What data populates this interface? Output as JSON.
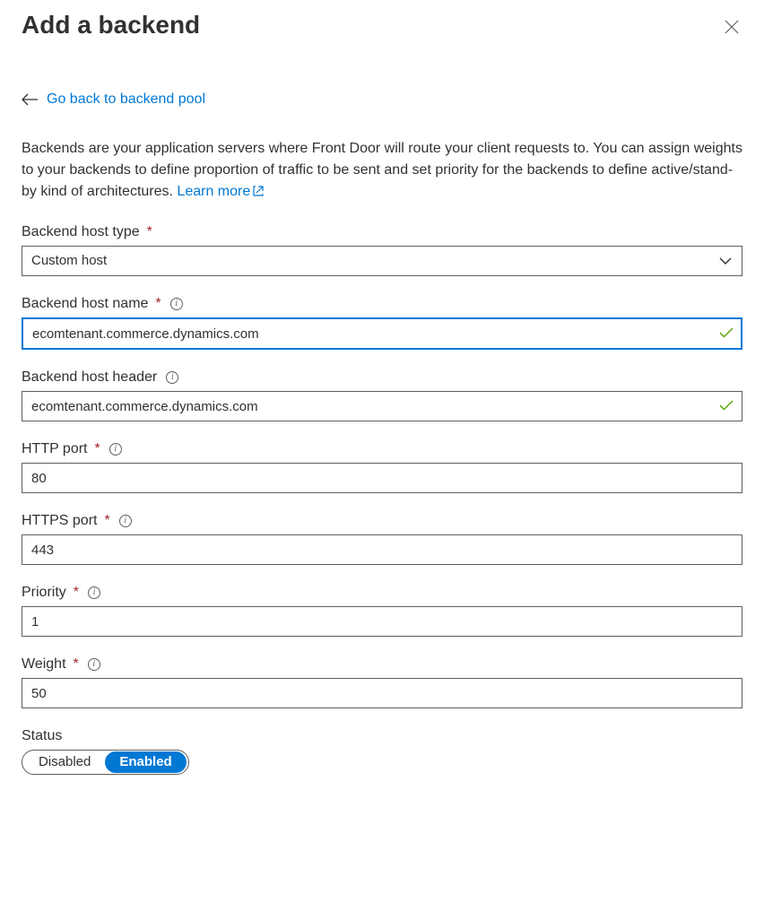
{
  "header": {
    "title": "Add a backend"
  },
  "nav": {
    "back_label": "Go back to backend pool"
  },
  "description": {
    "text": "Backends are your application servers where Front Door will route your client requests to. You can assign weights to your backends to define proportion of traffic to be sent and set priority for the backends to define active/stand-by kind of architectures. ",
    "learn_more": "Learn more"
  },
  "fields": {
    "host_type": {
      "label": "Backend host type",
      "value": "Custom host",
      "required": true
    },
    "host_name": {
      "label": "Backend host name",
      "value": "ecomtenant.commerce.dynamics.com",
      "required": true,
      "info": true
    },
    "host_header": {
      "label": "Backend host header",
      "value": "ecomtenant.commerce.dynamics.com",
      "info": true
    },
    "http_port": {
      "label": "HTTP port",
      "value": "80",
      "required": true,
      "info": true
    },
    "https_port": {
      "label": "HTTPS port",
      "value": "443",
      "required": true,
      "info": true
    },
    "priority": {
      "label": "Priority",
      "value": "1",
      "required": true,
      "info": true
    },
    "weight": {
      "label": "Weight",
      "value": "50",
      "required": true,
      "info": true
    },
    "status": {
      "label": "Status",
      "disabled": "Disabled",
      "enabled": "Enabled"
    }
  }
}
